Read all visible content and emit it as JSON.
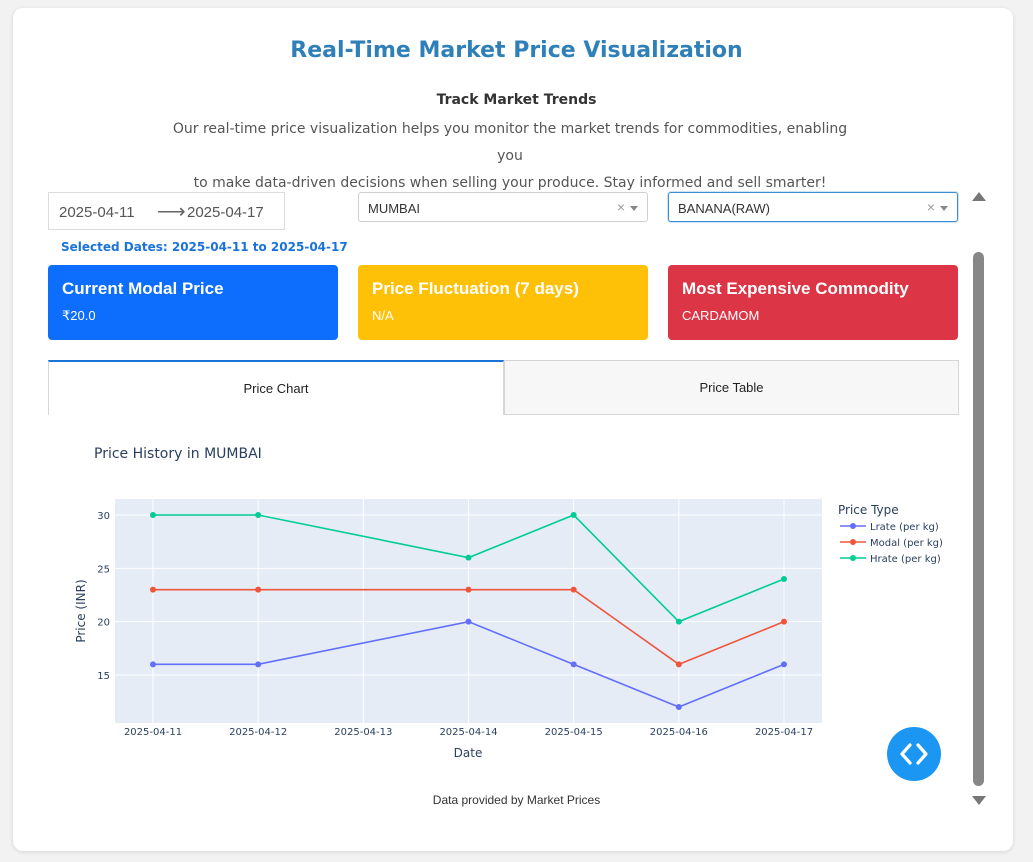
{
  "header": {
    "title": "Real-Time Market Price Visualization",
    "subtitle": "Track Market Trends",
    "description_line1": "Our real-time price visualization helps you monitor the market trends for commodities, enabling you",
    "description_line2": "to make data-driven decisions when selling your produce. Stay informed and sell smarter!"
  },
  "filters": {
    "start_date": "2025-04-11",
    "end_date": "2025-04-17",
    "date_arrow": "⟶",
    "selected_dates_text": "Selected Dates: 2025-04-11 to 2025-04-17",
    "market": "MUMBAI",
    "commodity": "BANANA(RAW)",
    "clear_symbol": "×"
  },
  "stats": [
    {
      "heading": "Current Modal Price",
      "value": "₹20.0",
      "color": "#0d6efd"
    },
    {
      "heading": "Price Fluctuation (7 days)",
      "value": "N/A",
      "color": "#ffc107"
    },
    {
      "heading": "Most Expensive Commodity",
      "value": "CARDAMOM",
      "color": "#dc3545"
    }
  ],
  "tabs": [
    {
      "label": "Price Chart",
      "active": true
    },
    {
      "label": "Price Table",
      "active": false
    }
  ],
  "chart_data": {
    "type": "line",
    "title": "Price History in MUMBAI",
    "xlabel": "Date",
    "ylabel": "Price (INR)",
    "x": [
      "2025-04-11",
      "2025-04-12",
      "2025-04-14",
      "2025-04-15",
      "2025-04-16",
      "2025-04-17"
    ],
    "x_ticks": [
      "2025-04-11",
      "2025-04-12",
      "2025-04-13",
      "2025-04-14",
      "2025-04-15",
      "2025-04-16",
      "2025-04-17"
    ],
    "y_ticks": [
      15,
      20,
      25,
      30
    ],
    "ylim": [
      10.5,
      31.5
    ],
    "legend_title": "Price Type",
    "legend_position": "top-right",
    "grid": true,
    "background": "#e5ecf6",
    "series": [
      {
        "name": "Lrate (per kg)",
        "color": "#636efa",
        "values": [
          16,
          16,
          20,
          16,
          12,
          16
        ]
      },
      {
        "name": "Modal (per kg)",
        "color": "#ef553b",
        "values": [
          23,
          23,
          23,
          23,
          16,
          20
        ]
      },
      {
        "name": "Hrate (per kg)",
        "color": "#00cc96",
        "values": [
          30,
          30,
          26,
          30,
          20,
          24
        ]
      }
    ]
  },
  "footer": {
    "text": "Data provided by Market Prices"
  }
}
